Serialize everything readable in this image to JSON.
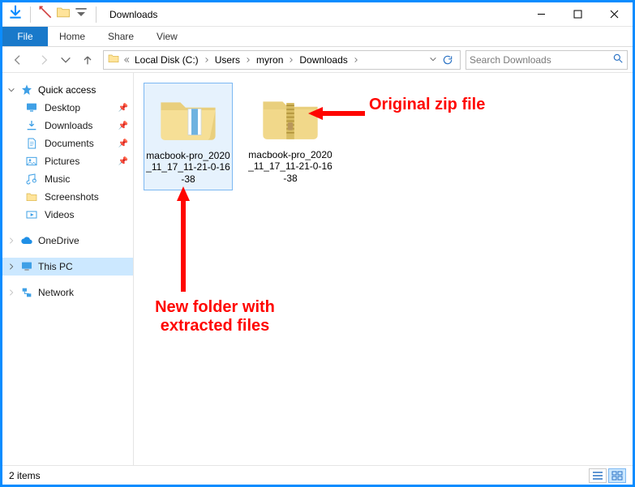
{
  "window": {
    "title": "Downloads"
  },
  "ribbon": {
    "file": "File",
    "tabs": [
      "Home",
      "Share",
      "View"
    ]
  },
  "breadcrumbs": {
    "prefix_mode": "double-chevron",
    "segments": [
      "Local Disk (C:)",
      "Users",
      "myron",
      "Downloads"
    ]
  },
  "search": {
    "placeholder": "Search Downloads"
  },
  "nav": {
    "quick_access": {
      "label": "Quick access",
      "items": [
        {
          "label": "Desktop",
          "icon": "desktop",
          "pinned": true
        },
        {
          "label": "Downloads",
          "icon": "downloads",
          "pinned": true
        },
        {
          "label": "Documents",
          "icon": "documents",
          "pinned": true
        },
        {
          "label": "Pictures",
          "icon": "pictures",
          "pinned": true
        },
        {
          "label": "Music",
          "icon": "music",
          "pinned": false
        },
        {
          "label": "Screenshots",
          "icon": "folder",
          "pinned": false
        },
        {
          "label": "Videos",
          "icon": "videos",
          "pinned": false
        }
      ]
    },
    "onedrive": {
      "label": "OneDrive"
    },
    "thispc": {
      "label": "This PC"
    },
    "network": {
      "label": "Network"
    }
  },
  "files": [
    {
      "name": "macbook-pro_2020_11_17_11-21-0-16-38",
      "kind": "folder",
      "selected": true
    },
    {
      "name": "macbook-pro_2020_11_17_11-21-0-16-38",
      "kind": "zip",
      "selected": false
    }
  ],
  "status": {
    "count_label": "2 items"
  },
  "annotations": {
    "right": "Original zip file",
    "bottom": "New folder with\nextracted files"
  },
  "colors": {
    "accent": "#1979ca",
    "selection": "#cce8ff",
    "anno": "#ff0500"
  }
}
